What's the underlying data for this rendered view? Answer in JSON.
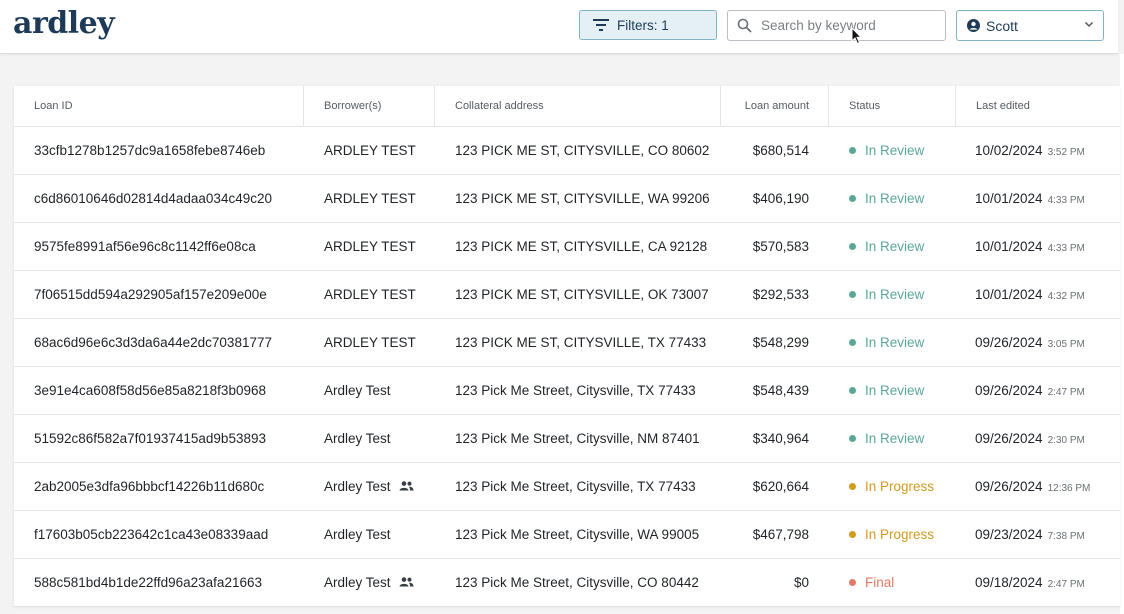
{
  "header": {
    "logo": "ardley",
    "filters_label": "Filters: 1",
    "search_placeholder": "Search by keyword",
    "user_name": "Scott"
  },
  "table": {
    "columns": {
      "loan_id": "Loan ID",
      "borrowers": "Borrower(s)",
      "address": "Collateral address",
      "amount": "Loan amount",
      "status": "Status",
      "last_edited": "Last edited"
    },
    "rows": [
      {
        "id": "33cfb1278b1257dc9a1658febe8746eb",
        "borrower": "ARDLEY TEST",
        "shared": false,
        "address": "123 PICK ME ST, CITYSVILLE, CO 80602",
        "amount": "$680,514",
        "status": "In Review",
        "date": "10/02/2024",
        "time": "3:52 PM"
      },
      {
        "id": "c6d86010646d02814d4adaa034c49c20",
        "borrower": "ARDLEY TEST",
        "shared": false,
        "address": "123 PICK ME ST, CITYSVILLE, WA 99206",
        "amount": "$406,190",
        "status": "In Review",
        "date": "10/01/2024",
        "time": "4:33 PM"
      },
      {
        "id": "9575fe8991af56e96c8c1142ff6e08ca",
        "borrower": "ARDLEY TEST",
        "shared": false,
        "address": "123 PICK ME ST, CITYSVILLE, CA 92128",
        "amount": "$570,583",
        "status": "In Review",
        "date": "10/01/2024",
        "time": "4:33 PM"
      },
      {
        "id": "7f06515dd594a292905af157e209e00e",
        "borrower": "ARDLEY TEST",
        "shared": false,
        "address": "123 PICK ME ST, CITYSVILLE, OK 73007",
        "amount": "$292,533",
        "status": "In Review",
        "date": "10/01/2024",
        "time": "4:32 PM"
      },
      {
        "id": "68ac6d96e6c3d3da6a44e2dc70381777",
        "borrower": "ARDLEY TEST",
        "shared": false,
        "address": "123 PICK ME ST, CITYSVILLE, TX 77433",
        "amount": "$548,299",
        "status": "In Review",
        "date": "09/26/2024",
        "time": "3:05 PM"
      },
      {
        "id": "3e91e4ca608f58d56e85a8218f3b0968",
        "borrower": "Ardley Test",
        "shared": false,
        "address": "123 Pick Me Street, Citysville, TX 77433",
        "amount": "$548,439",
        "status": "In Review",
        "date": "09/26/2024",
        "time": "2:47 PM"
      },
      {
        "id": "51592c86f582a7f01937415ad9b53893",
        "borrower": "Ardley Test",
        "shared": false,
        "address": "123 Pick Me Street, Citysville, NM 87401",
        "amount": "$340,964",
        "status": "In Review",
        "date": "09/26/2024",
        "time": "2:30 PM"
      },
      {
        "id": "2ab2005e3dfa96bbbcf14226b11d680c",
        "borrower": "Ardley Test",
        "shared": true,
        "address": "123 Pick Me Street, Citysville, TX 77433",
        "amount": "$620,664",
        "status": "In Progress",
        "date": "09/26/2024",
        "time": "12:36 PM"
      },
      {
        "id": "f17603b05cb223642c1ca43e08339aad",
        "borrower": "Ardley Test",
        "shared": false,
        "address": "123 Pick Me Street, Citysville, WA 99005",
        "amount": "$467,798",
        "status": "In Progress",
        "date": "09/23/2024",
        "time": "7:38 PM"
      },
      {
        "id": "588c581bd4b1de22ffd96a23afa21663",
        "borrower": "Ardley Test",
        "shared": true,
        "address": "123 Pick Me Street, Citysville, CO 80442",
        "amount": "$0",
        "status": "Final",
        "date": "09/18/2024",
        "time": "2:47 PM"
      }
    ]
  },
  "status_colors": {
    "In Review": "#5aa79a",
    "In Progress": "#d49a1f",
    "Final": "#e07a66"
  }
}
